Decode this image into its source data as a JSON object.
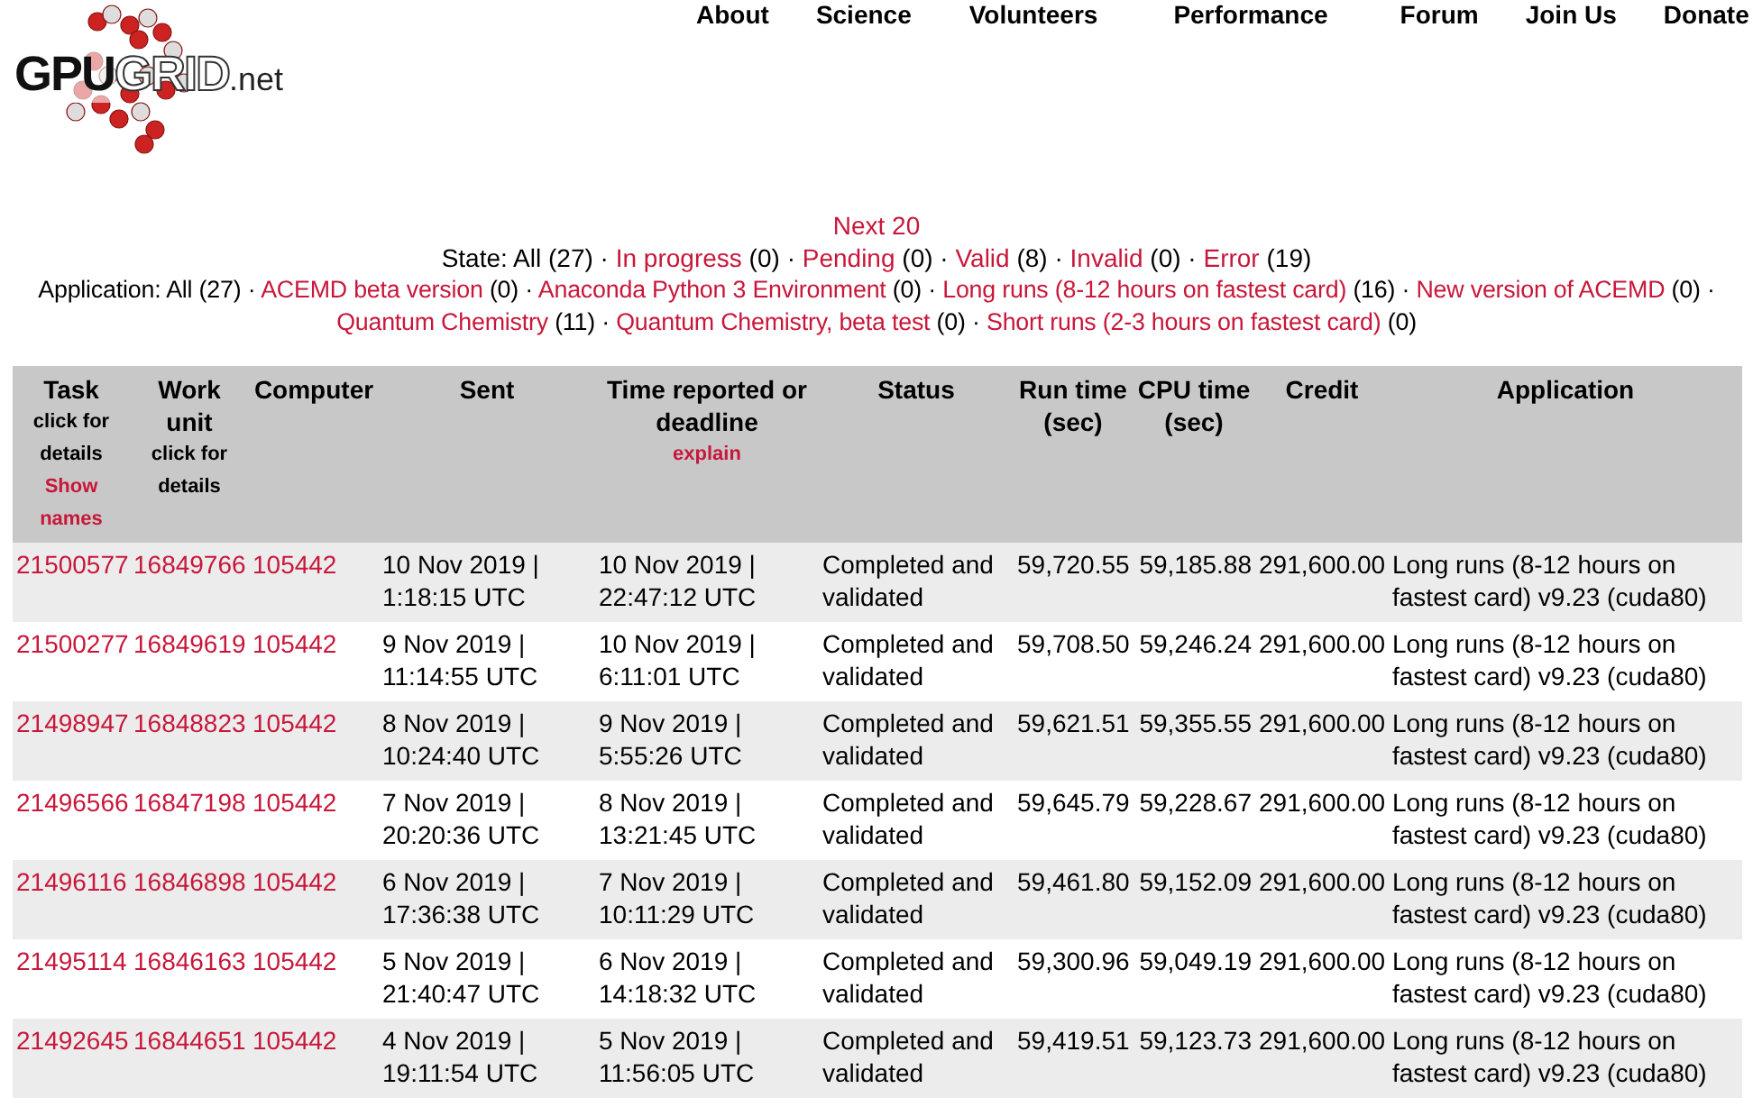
{
  "logo": {
    "parts": [
      {
        "text": "GPU",
        "kind": "solid"
      },
      {
        "text": "GRID",
        "kind": "outline"
      },
      {
        "text": ".net",
        "kind": "small"
      }
    ]
  },
  "nav": [
    "About",
    "Science",
    "Volunteers",
    "Performance",
    "Forum",
    "Join Us",
    "Donate"
  ],
  "next_link": "Next 20",
  "state_filter": {
    "label": "State:",
    "separator": "·",
    "items": [
      {
        "name": "All",
        "count": "(27)",
        "selected": true
      },
      {
        "name": "In progress",
        "count": "(0)",
        "selected": false
      },
      {
        "name": "Pending",
        "count": "(0)",
        "selected": false
      },
      {
        "name": "Valid",
        "count": "(8)",
        "selected": false
      },
      {
        "name": "Invalid",
        "count": "(0)",
        "selected": false
      },
      {
        "name": "Error",
        "count": "(19)",
        "selected": false
      }
    ]
  },
  "application_filter": {
    "label": "Application:",
    "separator": "·",
    "items": [
      {
        "name": "All",
        "count": "(27)",
        "selected": true
      },
      {
        "name": "ACEMD beta version",
        "count": "(0)",
        "selected": false
      },
      {
        "name": "Anaconda Python 3 Environment",
        "count": "(0)",
        "selected": false
      },
      {
        "name": "Long runs (8-12 hours on fastest card)",
        "count": "(16)",
        "selected": false
      },
      {
        "name": "New version of ACEMD",
        "count": "(0)",
        "selected": false
      },
      {
        "name": "Quantum Chemistry",
        "count": "(11)",
        "selected": false
      },
      {
        "name": "Quantum Chemistry, beta test",
        "count": "(0)",
        "selected": false
      },
      {
        "name": "Short runs (2-3 hours on fastest card)",
        "count": "(0)",
        "selected": false
      }
    ]
  },
  "table": {
    "columns": [
      {
        "title": "Task",
        "note": "click for details",
        "link": "Show names"
      },
      {
        "title": "Work unit",
        "note": "click for details"
      },
      {
        "title": "Computer"
      },
      {
        "title": "Sent"
      },
      {
        "title": "Time reported or deadline",
        "link": "explain"
      },
      {
        "title": "Status"
      },
      {
        "title": "Run time (sec)"
      },
      {
        "title": "CPU time (sec)"
      },
      {
        "title": "Credit"
      },
      {
        "title": "Application"
      }
    ],
    "rows": [
      {
        "task": "21500577",
        "work_unit": "16849766",
        "computer": "105442",
        "sent": "10 Nov 2019 | 1:18:15 UTC",
        "reported": "10 Nov 2019 | 22:47:12 UTC",
        "status": "Completed and validated",
        "run_time": "59,720.55",
        "cpu_time": "59,185.88",
        "credit": "291,600.00",
        "application": "Long runs (8-12 hours on fastest card) v9.23 (cuda80)"
      },
      {
        "task": "21500277",
        "work_unit": "16849619",
        "computer": "105442",
        "sent": "9 Nov 2019 | 11:14:55 UTC",
        "reported": "10 Nov 2019 | 6:11:01 UTC",
        "status": "Completed and validated",
        "run_time": "59,708.50",
        "cpu_time": "59,246.24",
        "credit": "291,600.00",
        "application": "Long runs (8-12 hours on fastest card) v9.23 (cuda80)"
      },
      {
        "task": "21498947",
        "work_unit": "16848823",
        "computer": "105442",
        "sent": "8 Nov 2019 | 10:24:40 UTC",
        "reported": "9 Nov 2019 | 5:55:26 UTC",
        "status": "Completed and validated",
        "run_time": "59,621.51",
        "cpu_time": "59,355.55",
        "credit": "291,600.00",
        "application": "Long runs (8-12 hours on fastest card) v9.23 (cuda80)"
      },
      {
        "task": "21496566",
        "work_unit": "16847198",
        "computer": "105442",
        "sent": "7 Nov 2019 | 20:20:36 UTC",
        "reported": "8 Nov 2019 | 13:21:45 UTC",
        "status": "Completed and validated",
        "run_time": "59,645.79",
        "cpu_time": "59,228.67",
        "credit": "291,600.00",
        "application": "Long runs (8-12 hours on fastest card) v9.23 (cuda80)"
      },
      {
        "task": "21496116",
        "work_unit": "16846898",
        "computer": "105442",
        "sent": "6 Nov 2019 | 17:36:38 UTC",
        "reported": "7 Nov 2019 | 10:11:29 UTC",
        "status": "Completed and validated",
        "run_time": "59,461.80",
        "cpu_time": "59,152.09",
        "credit": "291,600.00",
        "application": "Long runs (8-12 hours on fastest card) v9.23 (cuda80)"
      },
      {
        "task": "21495114",
        "work_unit": "16846163",
        "computer": "105442",
        "sent": "5 Nov 2019 | 21:40:47 UTC",
        "reported": "6 Nov 2019 | 14:18:32 UTC",
        "status": "Completed and validated",
        "run_time": "59,300.96",
        "cpu_time": "59,049.19",
        "credit": "291,600.00",
        "application": "Long runs (8-12 hours on fastest card) v9.23 (cuda80)"
      },
      {
        "task": "21492645",
        "work_unit": "16844651",
        "computer": "105442",
        "sent": "4 Nov 2019 | 19:11:54 UTC",
        "reported": "5 Nov 2019 | 11:56:05 UTC",
        "status": "Completed and validated",
        "run_time": "59,419.51",
        "cpu_time": "59,123.73",
        "credit": "291,600.00",
        "application": "Long runs (8-12 hours on fastest card) v9.23 (cuda80)"
      }
    ]
  }
}
